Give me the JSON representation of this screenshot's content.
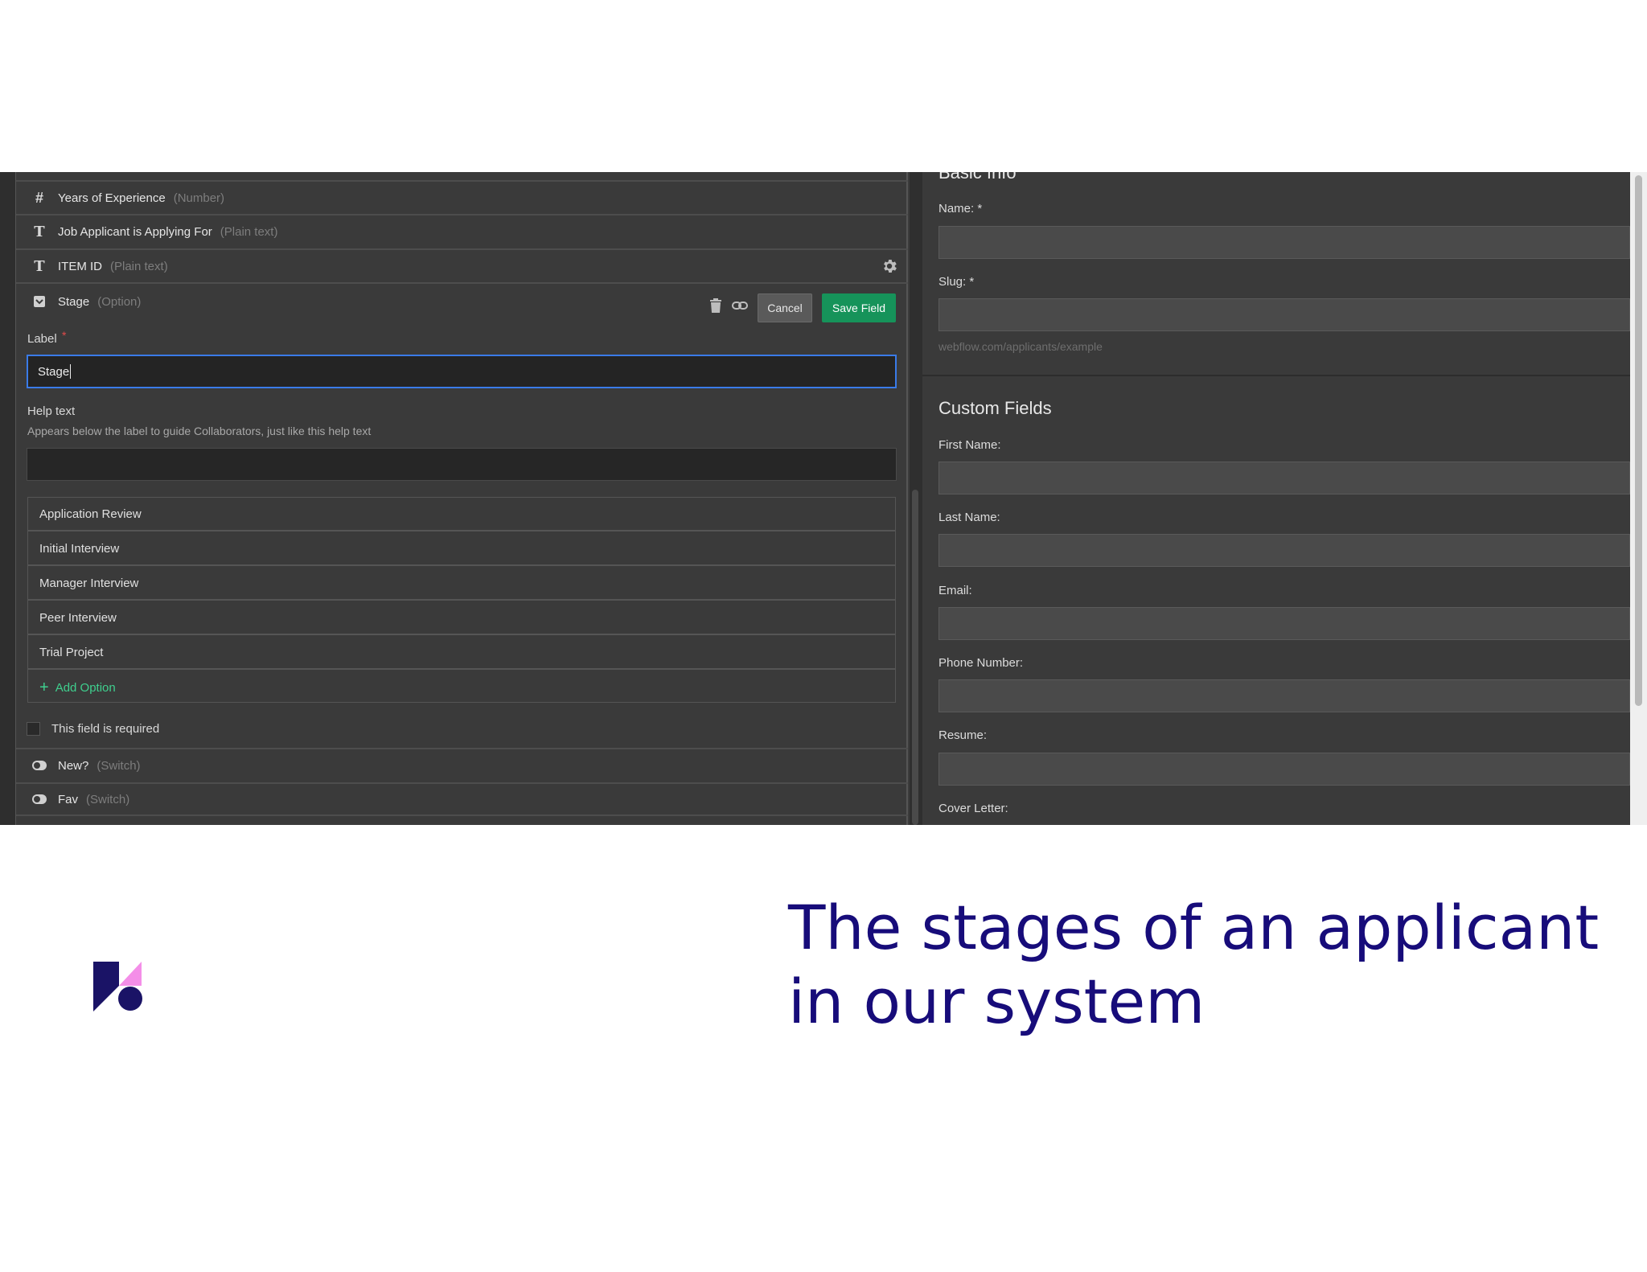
{
  "left_panel": {
    "fields_above": [
      {
        "icon": "hash-icon",
        "name": "Years of Experience",
        "type": "(Number)"
      },
      {
        "icon": "text-type-icon",
        "name": "Job Applicant is Applying For",
        "type": "(Plain text)"
      },
      {
        "icon": "text-type-icon",
        "name": "ITEM ID",
        "type": "(Plain text)"
      }
    ],
    "editing_field": {
      "name": "Stage",
      "type": "(Option)",
      "cancel_label": "Cancel",
      "save_label": "Save Field",
      "label_caption": "Label",
      "required_mark": "*",
      "label_value": "Stage",
      "help_caption": "Help text",
      "help_description": "Appears below the label to guide Collaborators, just like this help text",
      "help_value": "",
      "options": [
        "Application Review",
        "Initial Interview",
        "Manager Interview",
        "Peer Interview",
        "Trial Project"
      ],
      "add_option_label": "Add Option",
      "required_label": "This field is required"
    },
    "fields_below": [
      {
        "icon": "switch-toggle-icon",
        "name": "New?",
        "type": "(Switch)"
      },
      {
        "icon": "switch-toggle-icon",
        "name": "Fav",
        "type": "(Switch)"
      }
    ]
  },
  "right_panel": {
    "basic_info_title": "Basic Info",
    "name_label": "Name: *",
    "slug_label": "Slug: *",
    "slug_hint": "webflow.com/applicants/example",
    "custom_fields_title": "Custom Fields",
    "custom_fields": [
      "First Name:",
      "Last Name:",
      "Email:",
      "Phone Number:",
      "Resume:"
    ],
    "cover_letter_label": "Cover Letter:"
  },
  "caption": {
    "line1": "The stages of an applicant",
    "line2": "in our system"
  },
  "colors": {
    "caption": "#170c7a",
    "save_button": "#16935a",
    "add_option": "#3fcf8e",
    "focus_border": "#3a7be8",
    "logo_navy": "#1a1366",
    "logo_pink": "#f48ee8"
  }
}
